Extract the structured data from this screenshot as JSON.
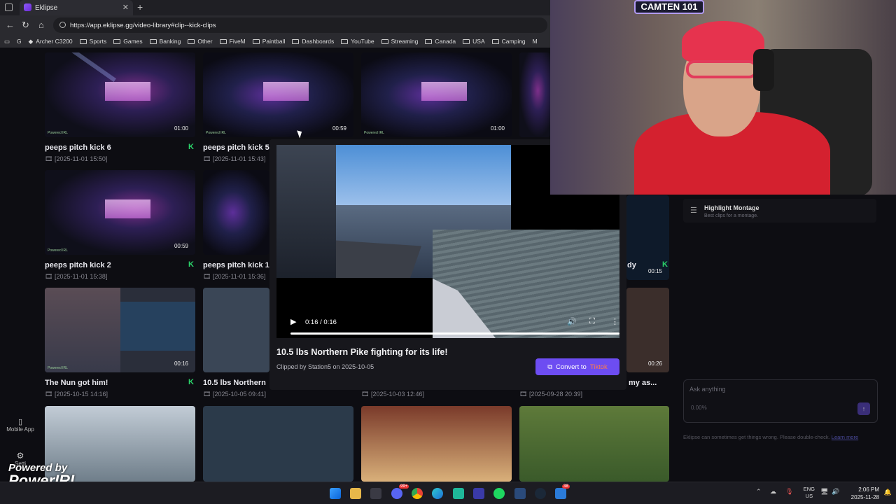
{
  "browser": {
    "tab_title": "Eklipse",
    "url": "https://app.eklipse.gg/video-library#clip--kick-clips",
    "bookmarks": [
      "Archer C3200",
      "Sports",
      "Games",
      "Banking",
      "Other",
      "FiveM",
      "Paintball",
      "Dashboards",
      "YouTube",
      "Streaming",
      "Canada",
      "USA",
      "Camping",
      "M"
    ]
  },
  "sidebar": {
    "mobile_app_label": "Mobile App",
    "settings_label": "Setti"
  },
  "clips": [
    {
      "title": "peeps pitch kick 6",
      "date": "[2025-11-01 15:50]",
      "duration": "01:00"
    },
    {
      "title": "peeps pitch kick 5",
      "date": "[2025-11-01 15:43]",
      "duration": "00:59"
    },
    {
      "title": "",
      "date": "",
      "duration": "01:00"
    },
    {
      "title": "peeps pitch kick 2",
      "date": "[2025-11-01 15:38]",
      "duration": "00:59"
    },
    {
      "title": "peeps pitch kick 1",
      "date": "[2025-11-01 15:36]",
      "duration": ""
    },
    {
      "title": "The Nun got him!",
      "date": "[2025-10-15 14:16]",
      "duration": "00:16"
    },
    {
      "title": "10.5 lbs Northern",
      "date": "[2025-10-05 09:41]",
      "duration": ""
    },
    {
      "title": "",
      "date": "[2025-10-03 12:46]",
      "duration": ""
    },
    {
      "title": "my as...",
      "date": "[2025-09-28 20:39]",
      "duration": "00:26"
    }
  ],
  "partial_right_clip": {
    "title_fragment": "dy",
    "duration": "00:15"
  },
  "thumb_watermark": "Powered IRL",
  "modal": {
    "time": "0:16 / 0:16",
    "title": "10.5 lbs Northern Pike fighting for its life!",
    "meta": "Clipped by Station5 on 2025-10-05",
    "convert_label": "Convert to",
    "convert_target": "Tiktok"
  },
  "right_panel": {
    "montage_title": "Highlight Montage",
    "montage_sub": "Best clips for a montage.",
    "ask_placeholder": "Ask anything",
    "ask_pct": "0.00%",
    "disclaimer": "Eklipse can sometimes get things wrong. Please double-check.",
    "learn_more": "Learn more"
  },
  "overlay": {
    "powered_by": "Powered by",
    "brand": "PowerIRL",
    "webcam_sign": "CAMTEN 101"
  },
  "taskbar": {
    "lang_top": "ENG",
    "lang_bottom": "US",
    "time": "2:06 PM",
    "date": "2025-11-28",
    "badge_discord": "99+",
    "badge_extra": "38"
  },
  "colors": {
    "accent": "#6d4df2",
    "kick_green": "#2bd46a",
    "tiktok_orange": "#ff7b4a"
  }
}
